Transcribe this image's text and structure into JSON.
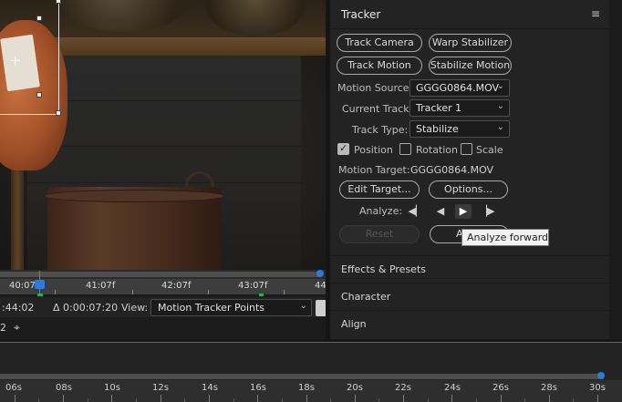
{
  "viewer": {
    "timeline_labels": [
      "40:07f",
      "41:07f",
      "42:07f",
      "43:07f",
      "44"
    ],
    "info_left": ":44:02",
    "info_delta": "Δ 0:00:07:20",
    "view_label": "View:",
    "view_value": "Motion Tracker Points",
    "row2_text": "2"
  },
  "tracker": {
    "title": "Tracker",
    "buttons": {
      "track_camera": "Track Camera",
      "warp_stabilizer": "Warp Stabilizer",
      "track_motion": "Track Motion",
      "stabilize_motion": "Stabilize Motion",
      "edit_target": "Edit Target...",
      "options": "Options...",
      "reset": "Reset",
      "apply": "Apply"
    },
    "motion_source_label": "Motion Source:",
    "motion_source_value": "GGGG0864.MOV",
    "current_track_label": "Current Track:",
    "current_track_value": "Tracker 1",
    "track_type_label": "Track Type:",
    "track_type_value": "Stabilize",
    "checkboxes": {
      "position": {
        "label": "Position",
        "checked": true
      },
      "rotation": {
        "label": "Rotation",
        "checked": false
      },
      "scale": {
        "label": "Scale",
        "checked": false
      }
    },
    "motion_target_label": "Motion Target:",
    "motion_target_value": "GGGG0864.MOV",
    "analyze_label": "Analyze:",
    "tooltip": "Analyze forward"
  },
  "sub_panels": [
    "Effects & Presets",
    "Character",
    "Align"
  ],
  "bottom_timeline": {
    "labels": [
      "06s",
      "08s",
      "10s",
      "12s",
      "14s",
      "16s",
      "18s",
      "20s",
      "22s",
      "24s",
      "26s",
      "28s",
      "30s"
    ]
  },
  "colors": {
    "accent_blue": "#2a7bdb",
    "playhead_red": "#d9524a",
    "work_area_green": "#2bb04a"
  }
}
